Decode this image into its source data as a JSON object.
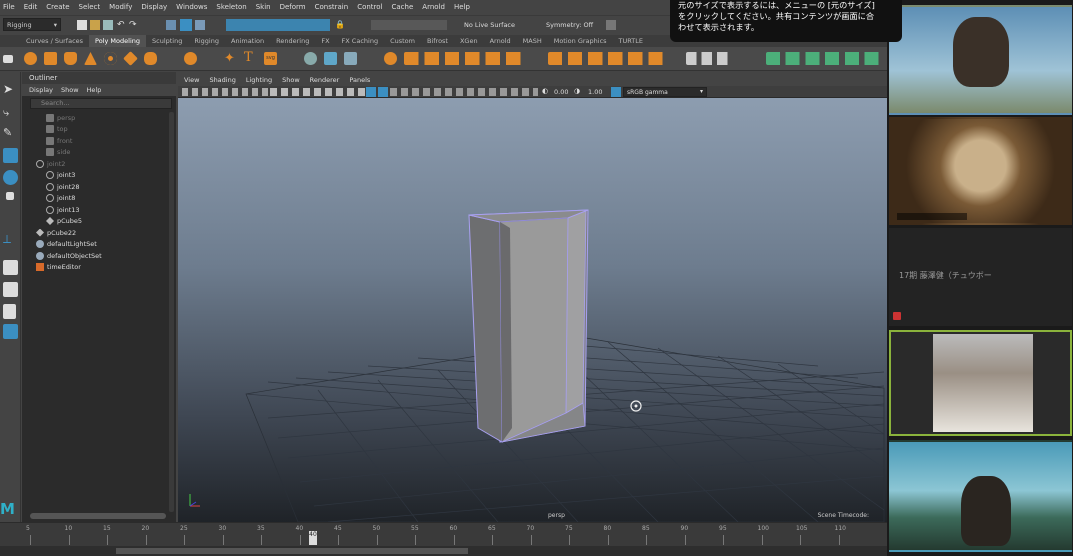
{
  "menubar": [
    "File",
    "Edit",
    "Create",
    "Select",
    "Modify",
    "Display",
    "Windows",
    "Skeleton",
    "Skin",
    "Deform",
    "Constrain",
    "Control",
    "Cache",
    "Arnold",
    "Help"
  ],
  "status": {
    "mode": "Rigging",
    "live_surface": "No Live Surface",
    "symmetry": "Symmetry: Off"
  },
  "shelf_tabs": [
    "Curves / Surfaces",
    "Poly Modeling",
    "Sculpting",
    "Rigging",
    "Animation",
    "Rendering",
    "FX",
    "FX Caching",
    "Custom",
    "Bifrost",
    "XGen",
    "Arnold",
    "MASH",
    "Motion Graphics",
    "TURTLE"
  ],
  "shelf_active": "Poly Modeling",
  "outliner": {
    "title": "Outliner",
    "menu": [
      "Display",
      "Show",
      "Help"
    ],
    "search_placeholder": "Search...",
    "items": [
      {
        "label": "persp",
        "style": "dim",
        "indent": 1,
        "icon": "camera-icon"
      },
      {
        "label": "top",
        "style": "dim",
        "indent": 1,
        "icon": "camera-icon"
      },
      {
        "label": "front",
        "style": "dim",
        "indent": 1,
        "icon": "camera-icon"
      },
      {
        "label": "side",
        "style": "dim",
        "indent": 1,
        "icon": "camera-icon"
      },
      {
        "label": "joint2",
        "style": "dim",
        "indent": 0,
        "icon": "joint-icon"
      },
      {
        "label": "joint3",
        "style": "lit",
        "indent": 1,
        "icon": "joint-icon"
      },
      {
        "label": "joint28",
        "style": "lit",
        "indent": 1,
        "icon": "joint-icon"
      },
      {
        "label": "joint8",
        "style": "lit",
        "indent": 1,
        "icon": "joint-icon"
      },
      {
        "label": "joint13",
        "style": "lit",
        "indent": 1,
        "icon": "joint-icon"
      },
      {
        "label": "pCube5",
        "style": "lit",
        "indent": 1,
        "icon": "mesh-icon"
      },
      {
        "label": "pCube22",
        "style": "lit",
        "indent": 0,
        "icon": "mesh-icon"
      },
      {
        "label": "defaultLightSet",
        "style": "lit",
        "indent": 0,
        "icon": "set-icon"
      },
      {
        "label": "defaultObjectSet",
        "style": "lit",
        "indent": 0,
        "icon": "set-icon"
      },
      {
        "label": "timeEditor",
        "style": "lit",
        "indent": 0,
        "icon": "time-editor-icon"
      }
    ]
  },
  "viewport": {
    "menu": [
      "View",
      "Shading",
      "Lighting",
      "Show",
      "Renderer",
      "Panels"
    ],
    "exposure": "0.00",
    "gamma": "1.00",
    "colorspace": "sRGB gamma",
    "camera_label": "persp",
    "timecode_label": "Scene Timecode:"
  },
  "timeline": {
    "ticks": [
      "5",
      "10",
      "15",
      "20",
      "25",
      "30",
      "35",
      "40",
      "45",
      "50",
      "55",
      "60",
      "65",
      "70",
      "75",
      "80",
      "85",
      "90",
      "95",
      "100",
      "105",
      "110"
    ],
    "current_frame": "40"
  },
  "notice": {
    "lines": [
      "元のサイズで表示するには、メニューの [元のサイズ]",
      "をクリックしてください。共有コンテンツが画面に合",
      "わせて表示されます。"
    ]
  },
  "participants": {
    "name_only_tile": "17期 藤澤健（チュウボー"
  },
  "colors": {
    "active_speaker_border": "#8bb33c",
    "maya_accent": "#3b8fc2",
    "shelf_orange": "#e0892a"
  }
}
